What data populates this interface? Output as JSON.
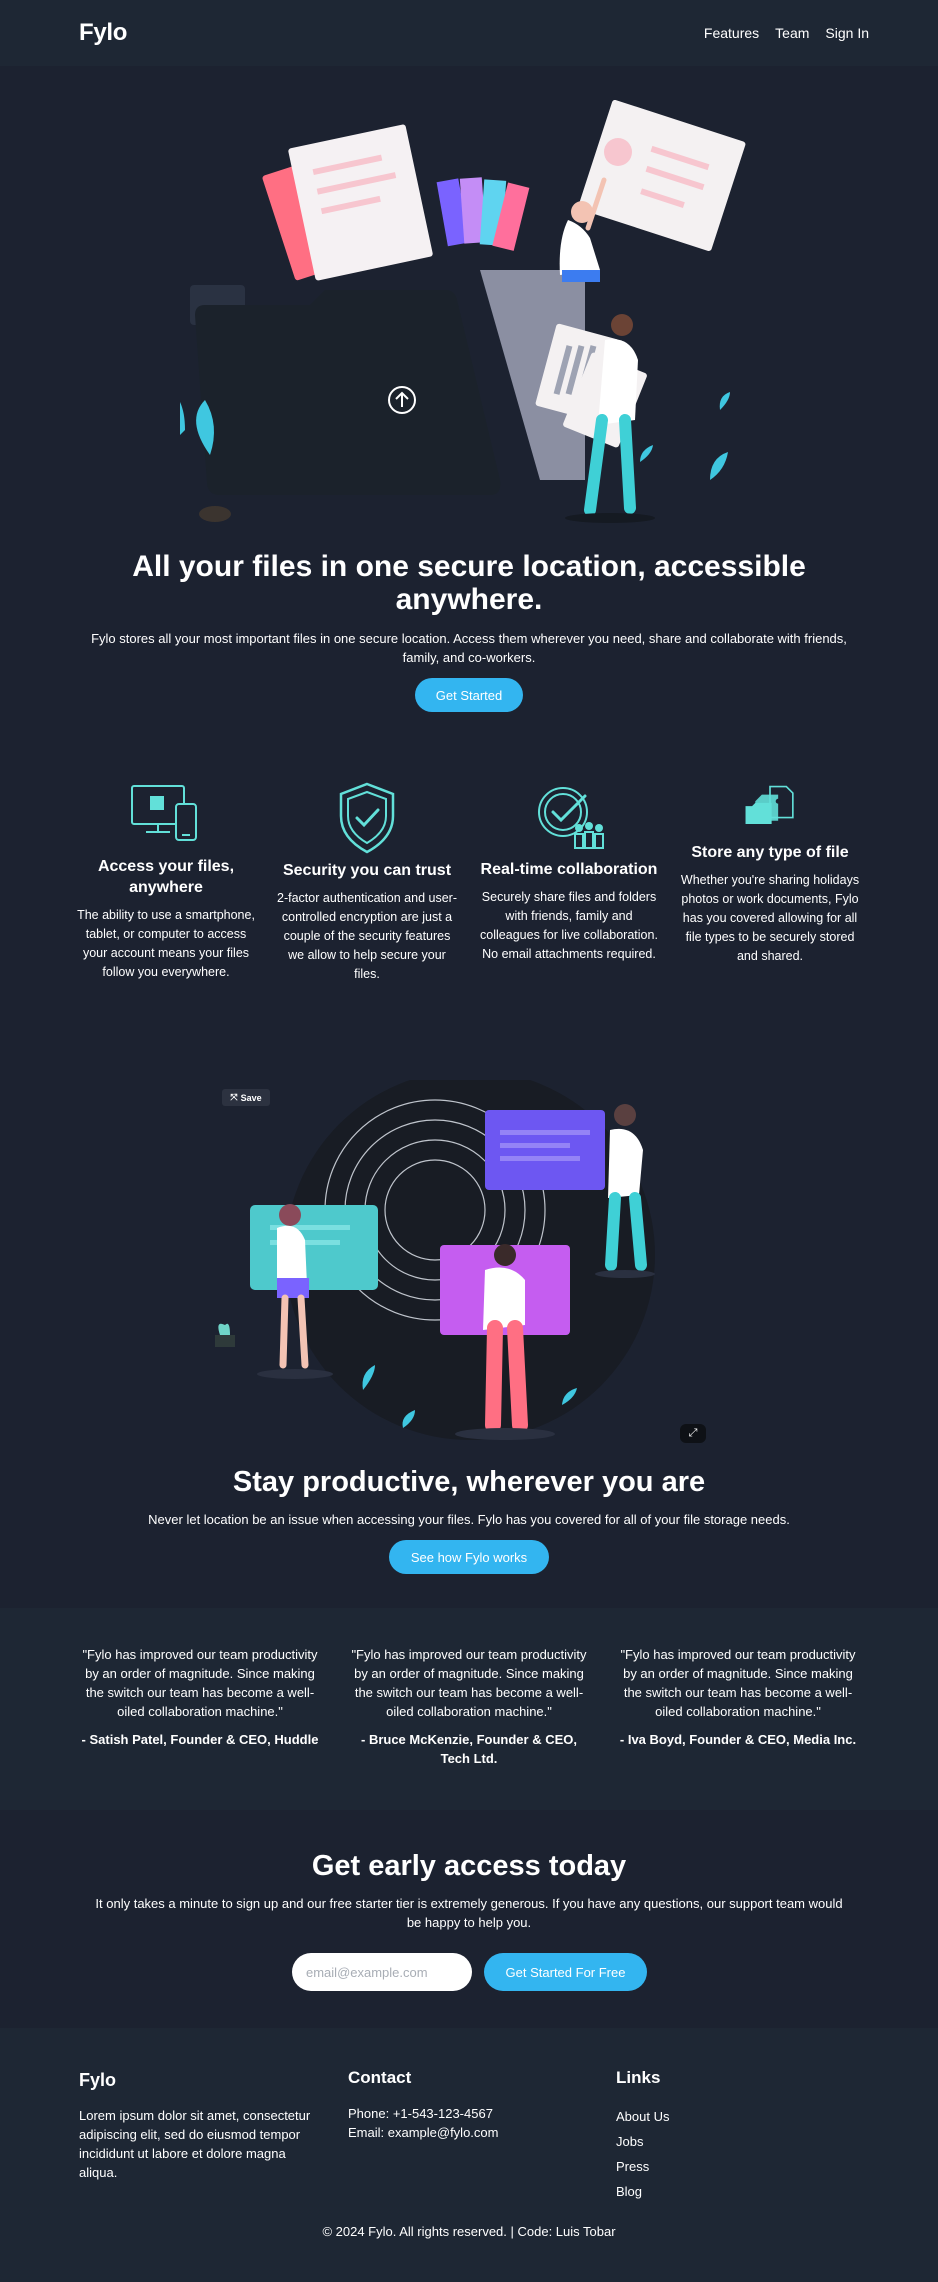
{
  "nav": {
    "logo": "Fylo",
    "links": [
      "Features",
      "Team",
      "Sign In"
    ]
  },
  "hero": {
    "title": "All your files in one secure location, accessible anywhere.",
    "subtitle": "Fylo stores all your most important files in one secure location. Access them wherever you need, share and collaborate with friends, family, and co-workers.",
    "cta": "Get Started"
  },
  "features": [
    {
      "icon": "devices-icon",
      "title": "Access your files, anywhere",
      "text": "The ability to use a smartphone, tablet, or computer to access your account means your files follow you everywhere."
    },
    {
      "icon": "shield-icon",
      "title": "Security you can trust",
      "text": "2-factor authentication and user-controlled encryption are just a couple of the security features we allow to help secure your files."
    },
    {
      "icon": "collaboration-icon",
      "title": "Real-time collaboration",
      "text": "Securely share files and folders with friends, family and colleagues for live collaboration. No email attachments required."
    },
    {
      "icon": "file-types-icon",
      "title": "Store any type of file",
      "text": "Whether you're sharing holidays photos or work documents, Fylo has you covered allowing for all file types to be securely stored and shared."
    }
  ],
  "productive": {
    "save_label": "Save",
    "title": "Stay productive, wherever you are",
    "subtitle": "Never let location be an issue when accessing your files. Fylo has you covered for all of your file storage needs.",
    "cta": "See how Fylo works"
  },
  "testimonials": [
    {
      "quote": "\"Fylo has improved our team productivity by an order of magnitude. Since making the switch our team has become a well-oiled collaboration machine.\"",
      "author": "- Satish Patel, Founder & CEO, Huddle"
    },
    {
      "quote": "\"Fylo has improved our team productivity by an order of magnitude. Since making the switch our team has become a well-oiled collaboration machine.\"",
      "author": "- Bruce McKenzie, Founder & CEO, Tech Ltd."
    },
    {
      "quote": "\"Fylo has improved our team productivity by an order of magnitude. Since making the switch our team has become a well-oiled collaboration machine.\"",
      "author": "- Iva Boyd, Founder & CEO, Media Inc."
    }
  ],
  "early_access": {
    "title": "Get early access today",
    "subtitle": "It only takes a minute to sign up and our free starter tier is extremely generous. If you have any questions, our support team would be happy to help you.",
    "email_placeholder": "email@example.com",
    "cta": "Get Started For Free"
  },
  "footer": {
    "brand": "Fylo",
    "about": "Lorem ipsum dolor sit amet, consectetur adipiscing elit, sed do eiusmod tempor incididunt ut labore et dolore magna aliqua.",
    "contact_title": "Contact",
    "phone": "Phone: +1-543-123-4567",
    "email": "Email: example@fylo.com",
    "links_title": "Links",
    "links": [
      "About Us",
      "Jobs",
      "Press",
      "Blog"
    ],
    "copyright": "© 2024 Fylo. All rights reserved. | Code: Luis Tobar"
  },
  "colors": {
    "background": "#1c2230",
    "panel": "#1e2734",
    "accent": "#33b5f0",
    "teal": "#62e0d9"
  }
}
